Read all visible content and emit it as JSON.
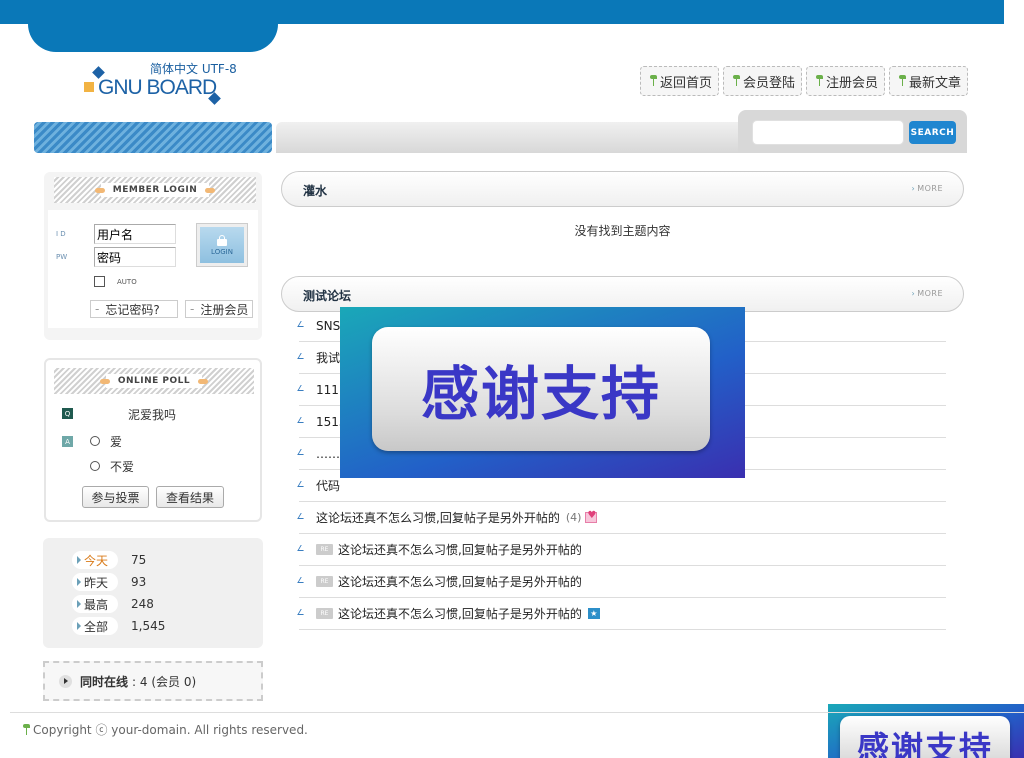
{
  "header": {
    "logo_lang": "简体中文 UTF-8",
    "logo_text": "GNU BOARD",
    "nav": [
      {
        "label": "返回首页"
      },
      {
        "label": "会员登陆"
      },
      {
        "label": "注册会员"
      },
      {
        "label": "最新文章"
      }
    ],
    "search": {
      "placeholder": "",
      "button_label": "SEARCH"
    }
  },
  "login": {
    "title": "MEMBER LOGIN",
    "id_label": "I D",
    "pw_label": "PW",
    "id_value": "用户名",
    "pw_value": "密码",
    "button_label": "LOGIN",
    "auto_label": "AUTO",
    "forgot_label": "忘记密码?",
    "register_label": "注册会员"
  },
  "poll": {
    "title": "ONLINE POLL",
    "q_badge": "Q",
    "a_badge": "A",
    "question": "泥爱我吗",
    "options": [
      "爱",
      "不爱"
    ],
    "vote_label": "参与投票",
    "result_label": "查看结果"
  },
  "stats": {
    "today_label": "今天",
    "today_value": "75",
    "yesterday_label": "昨天",
    "yesterday_value": "93",
    "max_label": "最高",
    "max_value": "248",
    "total_label": "全部",
    "total_value": "1,545"
  },
  "online": {
    "label": "同时在线",
    "value": ": 4 (会员 0)"
  },
  "boards": [
    {
      "title": "灌水",
      "more": "MORE",
      "empty": "没有找到主题内容"
    },
    {
      "title": "测试论坛",
      "more": "MORE"
    }
  ],
  "posts": [
    {
      "title": "SNSD"
    },
    {
      "title": "我试"
    },
    {
      "title": "1111"
    },
    {
      "title": "1515"
    },
    {
      "title": "……"
    },
    {
      "title": "代码"
    },
    {
      "title": "这论坛还真不怎么习惯,回复帖子是另外开帖的",
      "comments": "(4)"
    },
    {
      "re": "RE",
      "title": "这论坛还真不怎么习惯,回复帖子是另外开帖的"
    },
    {
      "re": "RE",
      "title": "这论坛还真不怎么习惯,回复帖子是另外开帖的"
    },
    {
      "re": "RE",
      "title": "这论坛还真不怎么习惯,回复帖子是另外开帖的"
    }
  ],
  "ad": {
    "text": "感谢支持"
  },
  "footer": {
    "copyright": "Copyright ⓒ your-domain. All rights reserved."
  },
  "colors": {
    "brand_blue": "#0a78b8",
    "search_button": "#1f86d0",
    "ad_text": "#3a37c6"
  }
}
